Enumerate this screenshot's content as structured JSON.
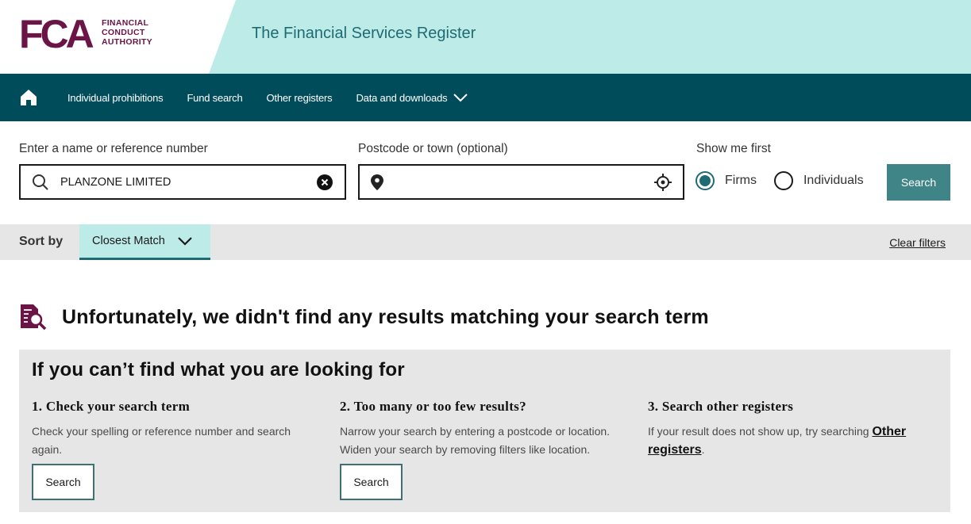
{
  "header": {
    "logo_letters": "FCA",
    "logo_text_lines": [
      "FINANCIAL",
      "CONDUCT",
      "AUTHORITY"
    ],
    "register_title": "The Financial Services Register",
    "band_color": "#bdebe8"
  },
  "nav": {
    "home_icon": "home-icon",
    "items": [
      {
        "label": "Individual prohibitions"
      },
      {
        "label": "Fund search"
      },
      {
        "label": "Other registers"
      },
      {
        "label": "Data and downloads",
        "icon": "chevron-down-icon"
      }
    ],
    "background_color": "#014c5a"
  },
  "search": {
    "name_label": "Enter a name or reference number",
    "name_value": "PLANZONE LIMITED",
    "postcode_label": "Postcode or town (optional)",
    "postcode_value": "",
    "show_first_label": "Show me first",
    "options": [
      {
        "label": "Firms",
        "selected": true
      },
      {
        "label": "Individuals",
        "selected": false
      }
    ],
    "search_button": "Search",
    "accent_color": "#3f8588"
  },
  "sort": {
    "label": "Sort by",
    "selected": "Closest Match",
    "clear_filters": "Clear filters"
  },
  "no_results": {
    "icon": "document-search-icon",
    "message": "Unfortunately, we didn't find any results matching your search term"
  },
  "help": {
    "title": "If you can’t find what you are looking for",
    "columns": [
      {
        "title": "1. Check your search term",
        "text": "Check your spelling or reference number and search again.",
        "button": "Search"
      },
      {
        "title": "2. Too many or too few results?",
        "text_line1": "Narrow your search by entering a postcode or location.",
        "text_line2": "Widen your search by removing filters like location.",
        "button": "Search"
      },
      {
        "title": "3. Search other registers",
        "text_prefix": "If your result does not show up, try searching ",
        "link": "Other registers",
        "text_suffix": "."
      }
    ]
  }
}
